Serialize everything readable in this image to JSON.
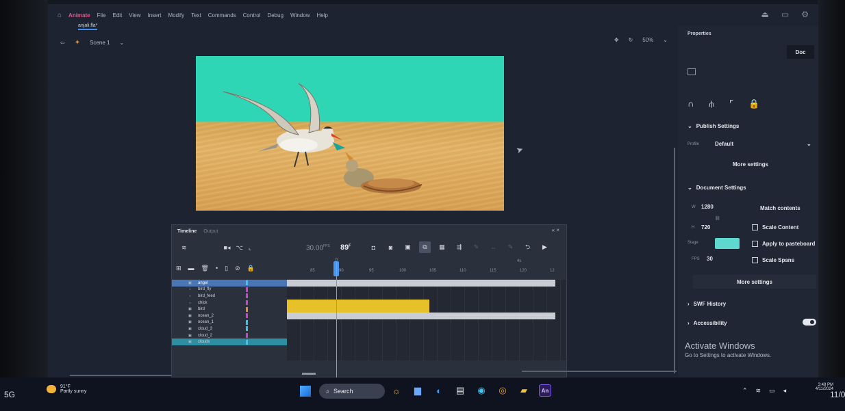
{
  "menubar": {
    "app_name": "Animate",
    "items": [
      "File",
      "Edit",
      "View",
      "Insert",
      "Modify",
      "Text",
      "Commands",
      "Control",
      "Debug",
      "Window",
      "Help"
    ]
  },
  "file_tab": "anjali.fla*",
  "scene": {
    "name": "Scene 1",
    "chevron": "⌄"
  },
  "zoom": {
    "value": "50%",
    "chevron": "⌄"
  },
  "timeline": {
    "tabs": {
      "active": "Timeline",
      "inactive": "Output"
    },
    "close_glyph": "« ×",
    "fps": "30.00",
    "fps_suffix": "FPS",
    "current_frame": "89",
    "frame_suffix": "F",
    "playhead_label": "2s",
    "top_label": "4s",
    "ruler": [
      "85",
      "90",
      "95",
      "100",
      "105",
      "110",
      "115",
      "120",
      "12"
    ],
    "layers": [
      {
        "name": "angel",
        "selected": true,
        "color": "#3fc4f0"
      },
      {
        "name": "bird_fly",
        "color": "#d43fcf"
      },
      {
        "name": "bird_feed",
        "color": "#d43fcf"
      },
      {
        "name": "chick",
        "color": "#d43fcf"
      },
      {
        "name": "bird",
        "color": "#f08a2a"
      },
      {
        "name": "ocean_2",
        "color": "#d43fcf"
      },
      {
        "name": "ocean_1",
        "color": "#3fc4f0"
      },
      {
        "name": "cloud_3",
        "color": "#3fc4f0"
      },
      {
        "name": "cloud_2",
        "color": "#d43fcf"
      },
      {
        "name": "clouds",
        "color": "#3fc4f0",
        "last": true
      }
    ]
  },
  "properties": {
    "title": "Properties",
    "doc_tab": "Doc",
    "publish_settings": {
      "label": "Publish Settings",
      "profile_label": "Profile",
      "profile_value": "Default",
      "more": "More settings"
    },
    "document_settings": {
      "label": "Document Settings",
      "w_label": "W",
      "w_value": "1280",
      "h_label": "H",
      "h_value": "720",
      "stage_label": "Stage",
      "stage_color": "#5fd8d0",
      "fps_label": "FPS",
      "fps_value": "30",
      "match_contents": "Match contents",
      "scale_content": "Scale Content",
      "apply_pasteboard": "Apply to pasteboard",
      "scale_spans": "Scale Spans",
      "more": "More settings"
    },
    "swf_history": "SWF History",
    "accessibility": "Accessibility",
    "activate_title": "Activate Windows",
    "activate_sub": "Go to Settings to activate Windows."
  },
  "taskbar": {
    "network": "5G",
    "weather_temp": "91°F",
    "weather_desc": "Partly sunny",
    "search": "Search",
    "an_label": "An",
    "time": "3:48 PM",
    "date": "4/11/2024",
    "page": "11/0"
  },
  "colors": {
    "accent": "#3d8ef0",
    "sky": "#2fd6b6",
    "sand": "#d9a755",
    "keyframe_yellow": "#e6c12a"
  }
}
